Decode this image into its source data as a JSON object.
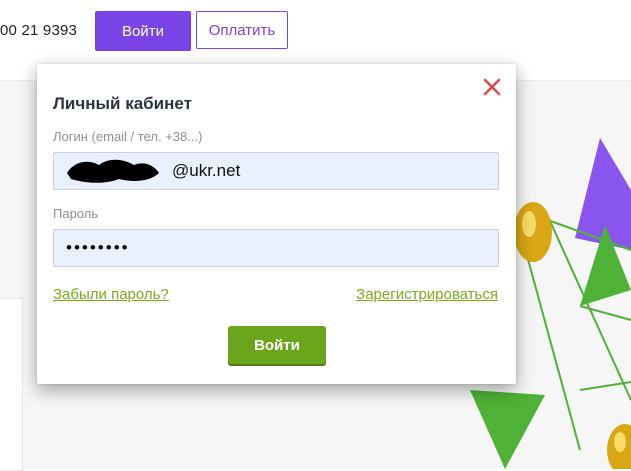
{
  "header": {
    "phone": "00 21 9393",
    "login_label": "Войти",
    "pay_label": "Оплатить"
  },
  "modal": {
    "title": "Личный кабинет",
    "login_label": "Логин (email / тел. +38...)",
    "login_value": "@ukr.net",
    "password_label": "Пароль",
    "password_value": "••••••••",
    "forgot_link": "Забыли пароль?",
    "register_link": "Зарегистрироваться",
    "submit_label": "Войти",
    "close_icon": "close-icon"
  },
  "colors": {
    "primary_purple": "#7a43e6",
    "accent_green": "#6aa51b",
    "link_green": "#7aab18",
    "close_red": "#e04848",
    "input_bg": "#e8f0fe"
  }
}
